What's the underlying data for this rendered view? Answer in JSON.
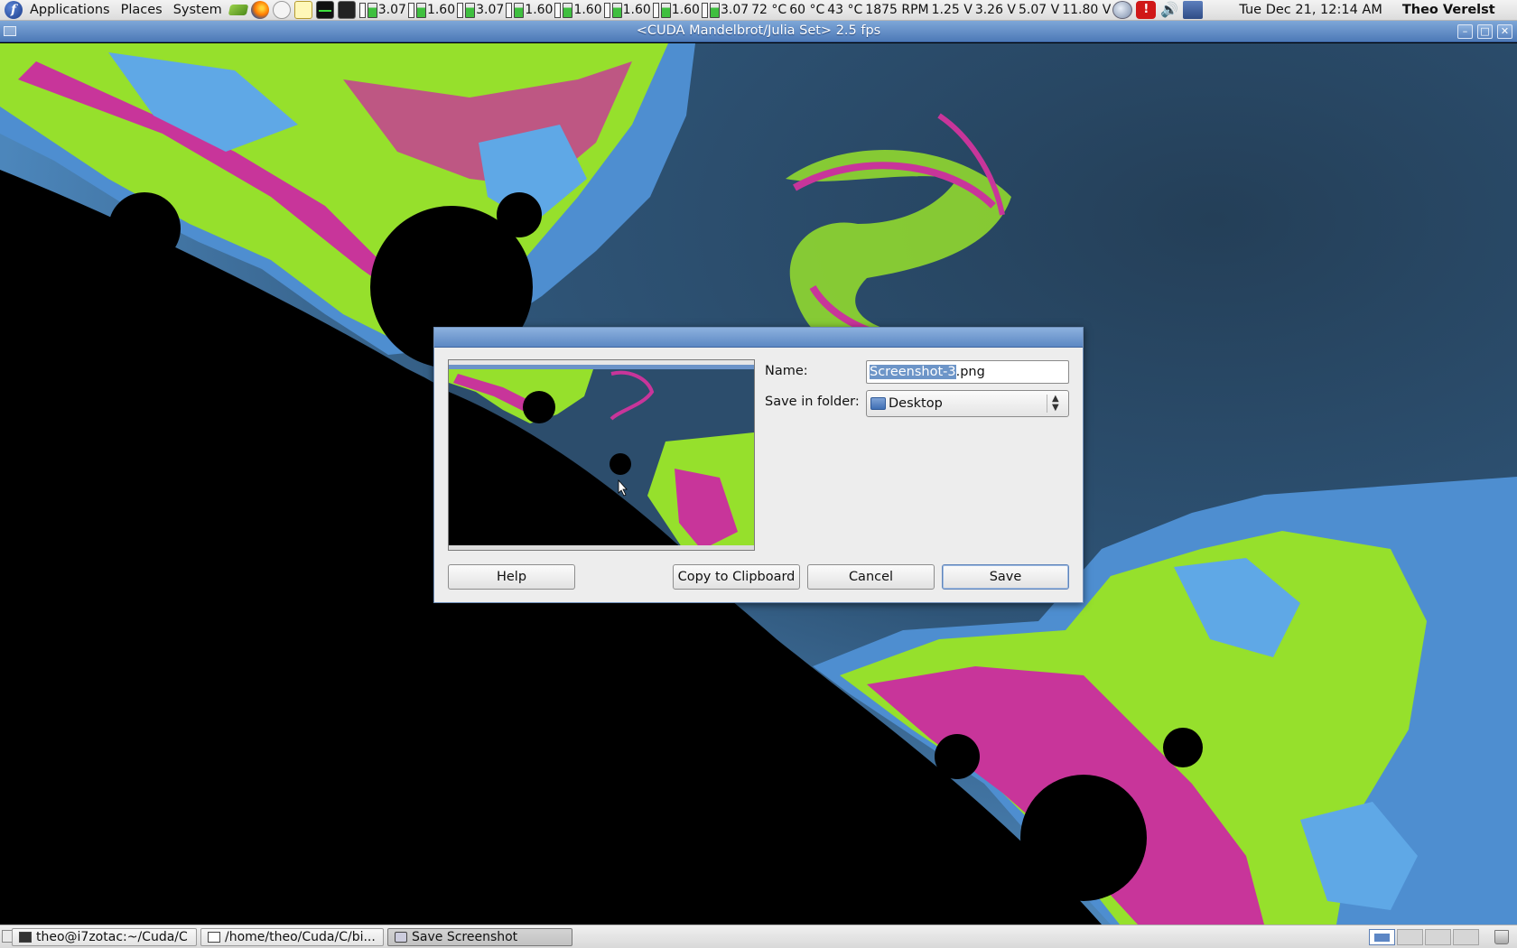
{
  "top_panel": {
    "menus": [
      "Applications",
      "Places",
      "System"
    ],
    "cpu_freqs": [
      "3.07",
      "1.60",
      "3.07",
      "1.60",
      "1.60",
      "1.60",
      "1.60",
      "3.07"
    ],
    "sensors": [
      "72 °C",
      "60 °C",
      "43 °C",
      "1875 RPM",
      "1.25 V",
      "3.26 V",
      "5.07 V",
      "11.80 V"
    ],
    "clock": "Tue Dec 21, 12:14 AM",
    "user": "Theo Verelst",
    "launcher_icons": [
      "nvidia-settings-icon",
      "firefox-icon",
      "clock-applet-icon",
      "text-editor-icon",
      "system-monitor-icon",
      "terminal-icon"
    ]
  },
  "window": {
    "title": "<CUDA Mandelbrot/Julia Set> 2.5 fps",
    "buttons": {
      "minimize": "–",
      "maximize": "□",
      "close": "✕"
    }
  },
  "dialog": {
    "name_label": "Name:",
    "name_value_selected": "Screenshot-3",
    "name_value_ext": ".png",
    "folder_label": "Save in folder:",
    "folder_value": "Desktop",
    "buttons": {
      "help": "Help",
      "copy": "Copy to Clipboard",
      "cancel": "Cancel",
      "save": "Save"
    }
  },
  "taskbar": {
    "tasks": [
      {
        "label": "theo@i7zotac:~/Cuda/C",
        "active": false
      },
      {
        "label": "/home/theo/Cuda/C/bi...",
        "active": false
      },
      {
        "label": "Save Screenshot",
        "active": true
      }
    ],
    "workspaces": 4,
    "current_workspace": 1
  },
  "colors": {
    "fractal_green": "#96e02c",
    "fractal_magenta": "#c8359a",
    "fractal_blue": "#4e8ed0",
    "fractal_dark": "#29465f"
  }
}
